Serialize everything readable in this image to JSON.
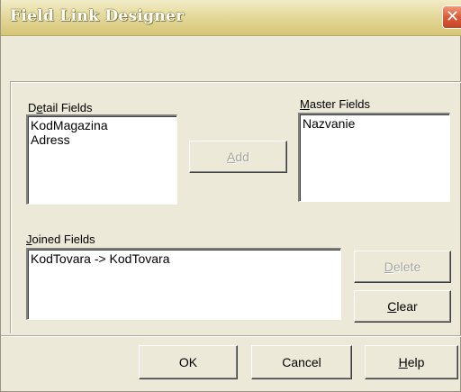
{
  "window": {
    "title": "Field Link Designer",
    "close_glyph": "✕"
  },
  "detail": {
    "label_pre": "D",
    "label_mn": "e",
    "label_post": "tail Fields",
    "items": [
      "KodMagazina",
      "Adress"
    ]
  },
  "master": {
    "label_mn": "M",
    "label_post": "aster Fields",
    "items": [
      "Nazvanie"
    ]
  },
  "add_button": {
    "label_mn": "A",
    "label_post": "dd",
    "enabled": false
  },
  "joined": {
    "label_mn": "J",
    "label_post": "oined Fields",
    "items": [
      "KodTovara -> KodTovara"
    ]
  },
  "delete_button": {
    "label_mn": "D",
    "label_post": "elete",
    "enabled": false
  },
  "clear_button": {
    "label_mn": "C",
    "label_post": "lear",
    "enabled": true
  },
  "footer": {
    "ok_label": "OK",
    "cancel_label": "Cancel",
    "help_mn": "H",
    "help_post": "elp"
  },
  "colors": {
    "dialog_bg": "#ece9d8",
    "titlebar": "#e6dba0",
    "close": "#d95b3a"
  }
}
